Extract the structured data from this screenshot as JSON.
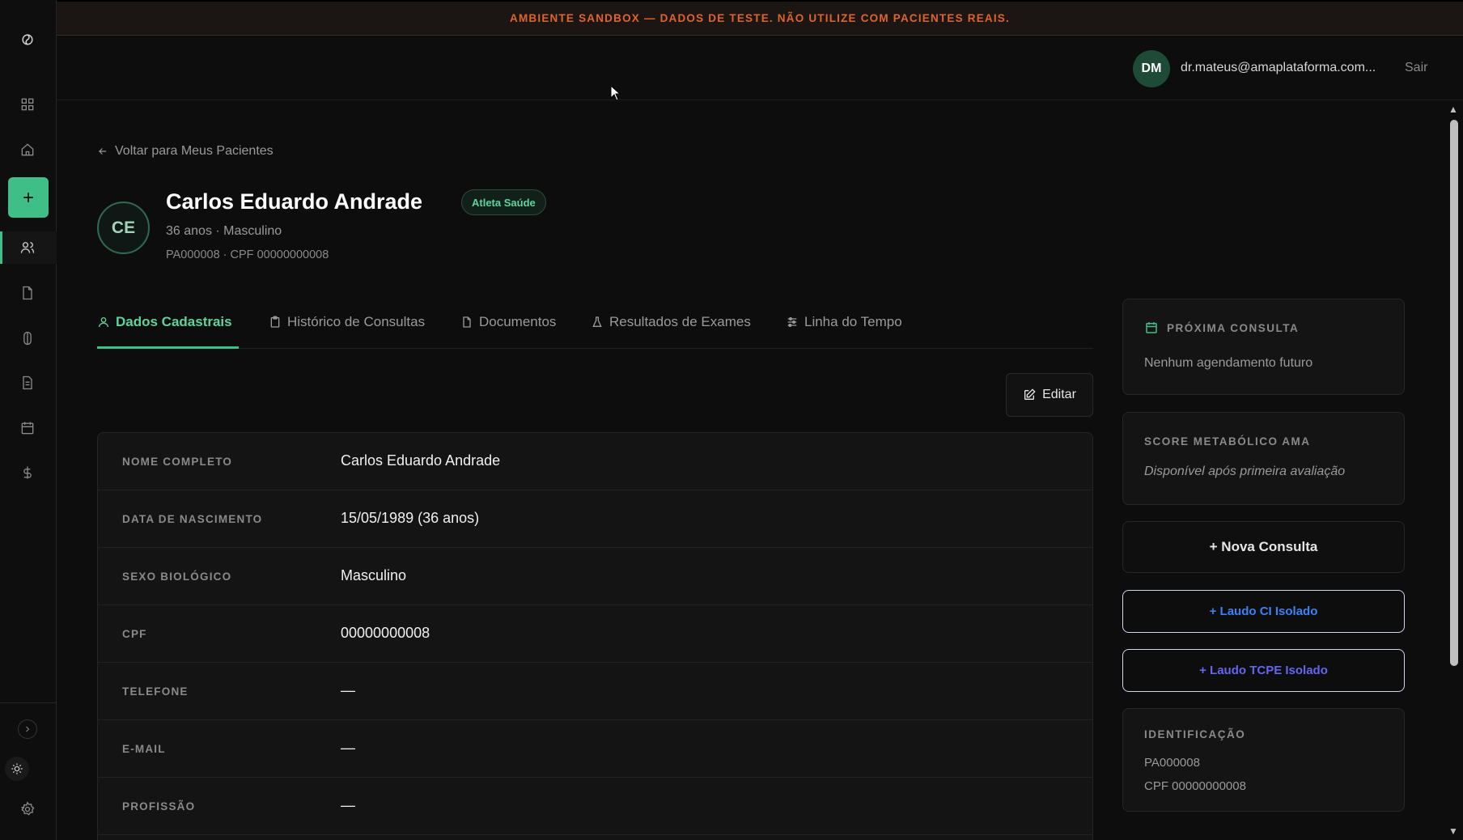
{
  "banner": {
    "text": "AMBIENTE SANDBOX — DADOS DE TESTE. NÃO UTILIZE COM PACIENTES REAIS."
  },
  "user": {
    "initials": "DM",
    "email": "dr.mateus@amaplataforma.com...",
    "logout_label": "Sair"
  },
  "sidebar": {
    "icons": [
      "logo-icon",
      "dashboard-icon",
      "home-icon",
      "plus-icon",
      "users-icon",
      "file-icon",
      "pill-icon",
      "document-icon",
      "calendar-icon",
      "dollar-icon",
      "chevron-right-icon",
      "sun-icon",
      "gear-icon"
    ],
    "active_item": "users"
  },
  "back_link": "Voltar para Meus Pacientes",
  "patient": {
    "initials": "CE",
    "name": "Carlos Eduardo Andrade",
    "badge": "Atleta Saúde",
    "meta": "36 anos · Masculino",
    "ids": "PA000008 · CPF 00000000008"
  },
  "tabs": [
    {
      "label": "Dados Cadastrais",
      "icon": "user-icon",
      "active": true
    },
    {
      "label": "Histórico de Consultas",
      "icon": "clipboard-icon",
      "active": false
    },
    {
      "label": "Documentos",
      "icon": "file-icon",
      "active": false
    },
    {
      "label": "Resultados de Exames",
      "icon": "flask-icon",
      "active": false
    },
    {
      "label": "Linha do Tempo",
      "icon": "sliders-icon",
      "active": false
    }
  ],
  "edit_label": "Editar",
  "details": [
    {
      "label": "NOME COMPLETO",
      "value": "Carlos Eduardo Andrade"
    },
    {
      "label": "DATA DE NASCIMENTO",
      "value": "15/05/1989 (36 anos)"
    },
    {
      "label": "SEXO BIOLÓGICO",
      "value": "Masculino"
    },
    {
      "label": "CPF",
      "value": "00000000008"
    },
    {
      "label": "TELEFONE",
      "value": "—"
    },
    {
      "label": "E-MAIL",
      "value": "—"
    },
    {
      "label": "PROFISSÃO",
      "value": "—"
    }
  ],
  "next_consult": {
    "title": "PRÓXIMA CONSULTA",
    "text": "Nenhum agendamento futuro"
  },
  "score": {
    "title": "SCORE METABÓLICO AMA",
    "text": "Disponível após primeira avaliação"
  },
  "actions": {
    "nova_consulta": "+ Nova Consulta",
    "laudo_ci": "+ Laudo CI Isolado",
    "laudo_tcpe": "+ Laudo TCPE Isolado"
  },
  "identificacao": {
    "title": "IDENTIFICAÇÃO",
    "patient_id": "PA000008",
    "cpf": "CPF 00000000008"
  },
  "colors": {
    "accent": "#3fbf87",
    "warning": "#e0642a",
    "link_blue": "#3b82f6",
    "link_indigo": "#6366f1"
  }
}
